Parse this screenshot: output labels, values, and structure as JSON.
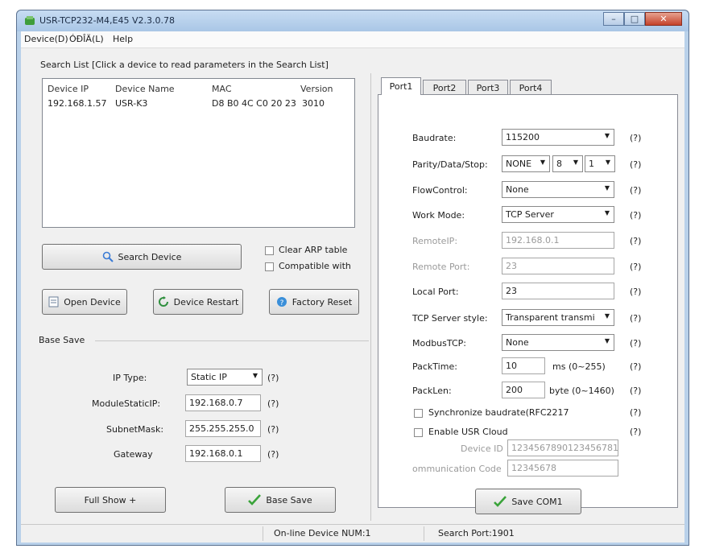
{
  "window": {
    "title": "USR-TCP232-M4,E45 V2.3.0.78",
    "colors": {
      "titlebar": "#b9d1ea",
      "close": "#c5422a"
    }
  },
  "menu": [
    "Device(D)",
    "ÓÐÎÄ(L)",
    "Help"
  ],
  "search": {
    "heading": "Search List [Click a device to read parameters in the Search List]",
    "columns": [
      "Device IP",
      "Device Name",
      "MAC",
      "Version"
    ],
    "rows": [
      {
        "ip": "192.168.1.57",
        "name": "USR-K3",
        "mac": "D8 B0 4C C0 20 23",
        "version": "3010"
      }
    ]
  },
  "buttons": {
    "search_device": "Search Device",
    "clear_arp": "Clear ARP table",
    "compatible": "Compatible with",
    "open_device": "Open Device",
    "device_restart": "Device Restart",
    "factory_reset": "Factory Reset",
    "full_show": "Full Show +",
    "base_save": "Base Save",
    "save_com": "Save COM1"
  },
  "base": {
    "group": "Base Save",
    "ip_type_label": "IP   Type:",
    "ip_type": "Static IP",
    "static_ip_label": "ModuleStaticIP:",
    "static_ip": "192.168.0.7",
    "mask_label": "SubnetMask:",
    "mask": "255.255.255.0",
    "gateway_label": "Gateway",
    "gateway": "192.168.0.1",
    "help": "(?)"
  },
  "tabs": [
    "Port1",
    "Port2",
    "Port3",
    "Port4"
  ],
  "port": {
    "baudrate_label": "Baudrate:",
    "baudrate": "115200",
    "parity_label": "Parity/Data/Stop:",
    "parity": "NONE",
    "data": "8",
    "stop": "1",
    "flow_label": "FlowControl:",
    "flow": "None",
    "mode_label": "Work Mode:",
    "mode": "TCP Server",
    "remote_ip_label": "RemoteIP:",
    "remote_ip": "192.168.0.1",
    "remote_port_label": "Remote Port:",
    "remote_port": "23",
    "local_port_label": "Local Port:",
    "local_port": "23",
    "tcp_style_label": "TCP Server style:",
    "tcp_style": "Transparent transmi",
    "modbus_label": "ModbusTCP:",
    "modbus": "None",
    "packtime_label": "PackTime:",
    "packtime": "10",
    "packtime_unit": "ms (0~255)",
    "packlen_label": "PackLen:",
    "packlen": "200",
    "packlen_unit": "byte (0~1460)",
    "sync_label": "Synchronize baudrate(RFC2217",
    "cloud_label": "Enable USR Cloud",
    "device_id_label": "Device ID",
    "device_id": "1234567890123456781",
    "comm_code_label": "ommunication Code",
    "comm_code": "12345678",
    "help": "(?)"
  },
  "status": {
    "online": "On-line Device NUM:1",
    "search_port": "Search Port:1901"
  }
}
